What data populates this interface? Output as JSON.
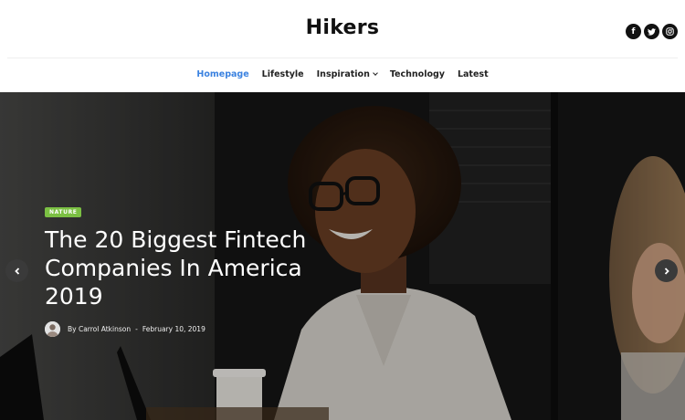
{
  "site": {
    "logo": "Hikers"
  },
  "social": [
    {
      "icon": "facebook-icon",
      "glyph": "f"
    },
    {
      "icon": "twitter-icon",
      "glyph": ""
    },
    {
      "icon": "instagram-icon",
      "glyph": ""
    }
  ],
  "nav": {
    "items": [
      {
        "label": "Homepage",
        "active": true
      },
      {
        "label": "Lifestyle"
      },
      {
        "label": "Inspiration",
        "dropdown": true
      },
      {
        "label": "Technology"
      },
      {
        "label": "Latest"
      }
    ]
  },
  "hero": {
    "category": "NATURE",
    "title": "The 20 Biggest Fintech Companies In America 2019",
    "author": "By Carrol Atkinson",
    "separator": "-",
    "date": "February 10, 2019"
  },
  "colors": {
    "accent": "#3b82e0",
    "badge": "#7bc043"
  }
}
